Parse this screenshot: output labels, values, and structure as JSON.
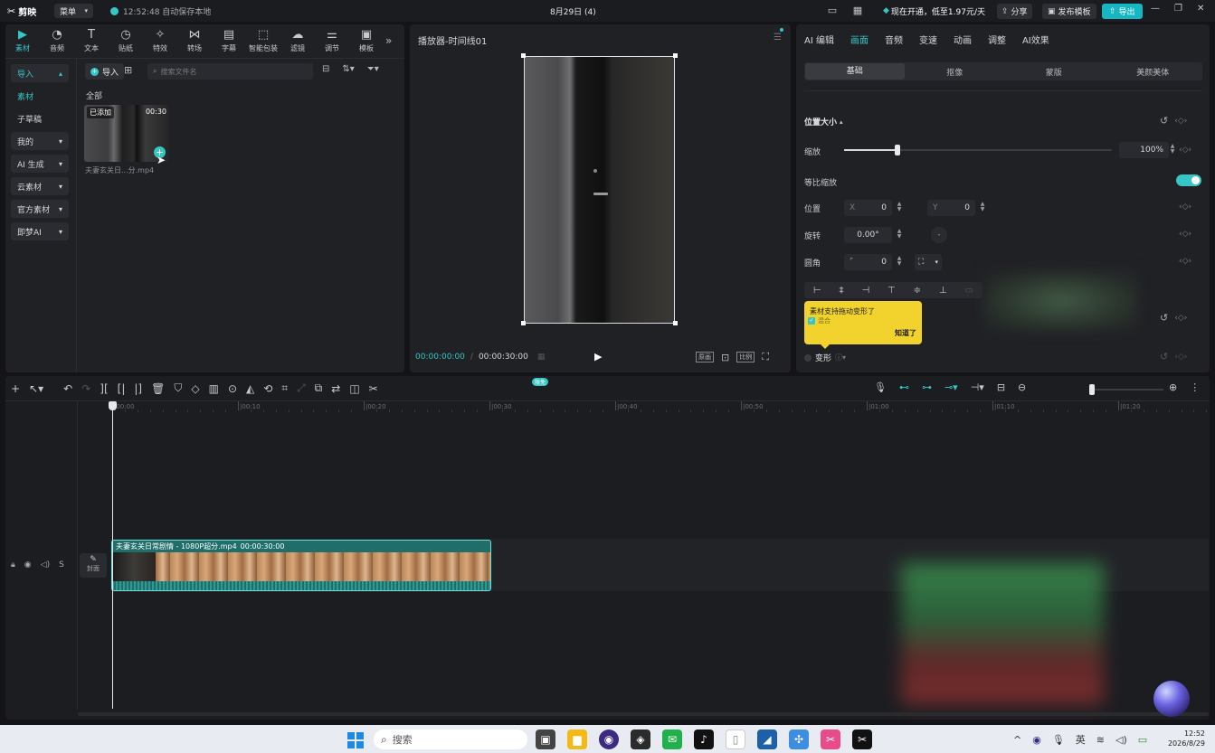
{
  "titlebar": {
    "app_name": "剪映",
    "menu_label": "菜单",
    "autosave": "12:52:48 自动保存本地",
    "project_title": "8月29日 (4)",
    "vip_text": "现在开通，低至1.97元/天",
    "share_label": "分享",
    "publish_label": "发布模板",
    "export_label": "导出"
  },
  "media_toolbar": [
    {
      "label": "素材",
      "icon": "media-icon"
    },
    {
      "label": "音频",
      "icon": "audio-icon"
    },
    {
      "label": "文本",
      "icon": "text-icon"
    },
    {
      "label": "贴纸",
      "icon": "sticker-icon"
    },
    {
      "label": "特效",
      "icon": "effects-icon"
    },
    {
      "label": "转场",
      "icon": "transition-icon"
    },
    {
      "label": "字幕",
      "icon": "caption-icon"
    },
    {
      "label": "智能包装",
      "icon": "smart-pack-icon"
    },
    {
      "label": "滤镜",
      "icon": "filter-icon"
    },
    {
      "label": "调节",
      "icon": "adjust-icon"
    },
    {
      "label": "模板",
      "icon": "template-icon"
    }
  ],
  "sidebar": {
    "items": [
      {
        "label": "导入",
        "caret": "⌃"
      },
      {
        "label": "素材",
        "caret": ""
      },
      {
        "label": "子草稿",
        "caret": ""
      },
      {
        "label": "我的",
        "caret": "⌄"
      },
      {
        "label": "AI 生成",
        "caret": "⌄"
      },
      {
        "label": "云素材",
        "caret": "⌄"
      },
      {
        "label": "官方素材",
        "caret": "⌄"
      },
      {
        "label": "即梦AI",
        "caret": "⌄"
      }
    ]
  },
  "media": {
    "import_label": "导入",
    "search_placeholder": "搜索文件名",
    "section_label": "全部",
    "clip": {
      "badge": "已添加",
      "duration": "00:30",
      "filename": "夫妻玄关日...分.mp4"
    }
  },
  "player": {
    "title": "播放器-时间线01",
    "current_time": "00:00:00:00",
    "total_time": "00:00:30:00",
    "btn_original": "原画",
    "btn_ratio": "比例"
  },
  "props": {
    "tabs": [
      "AI 编辑",
      "画面",
      "音频",
      "变速",
      "动画",
      "调整",
      "AI效果"
    ],
    "subtabs": [
      "基础",
      "抠像",
      "蒙版",
      "美颜美体"
    ],
    "section_title": "位置大小",
    "scale_label": "缩放",
    "scale_value": "100%",
    "scale_level": 0.2,
    "uniform_label": "等比缩放",
    "position_label": "位置",
    "x_prefix": "X",
    "x_value": "0",
    "y_prefix": "Y",
    "y_value": "0",
    "rotate_label": "旋转",
    "rotate_value": "0.00°",
    "corner_label": "圆角",
    "corner_value": "0",
    "tooltip_text": "素材支持拖动变形了",
    "tooltip_under": "混合",
    "tooltip_button": "知道了",
    "transform_label": "变形"
  },
  "timeline": {
    "ruler": [
      "00:00",
      "00:10",
      "00:20",
      "00:30",
      "00:40",
      "00:50",
      "01:00",
      "01:10",
      "01:20"
    ],
    "free_badge": "限免",
    "clip_title": "夫妻玄关日常剧情 - 1080P超分.mp4",
    "clip_duration": "00:00:30:00",
    "cover_label": "封面",
    "track_ctrl_s": "S"
  },
  "taskbar": {
    "search_label": "搜索",
    "ime": "英",
    "time": "12:52",
    "date": "2026/8/29"
  },
  "colors": {
    "accent": "#35c6c5",
    "export": "#16b6c2",
    "tooltip": "#f2d22d",
    "clip": "#1f6e6a"
  }
}
